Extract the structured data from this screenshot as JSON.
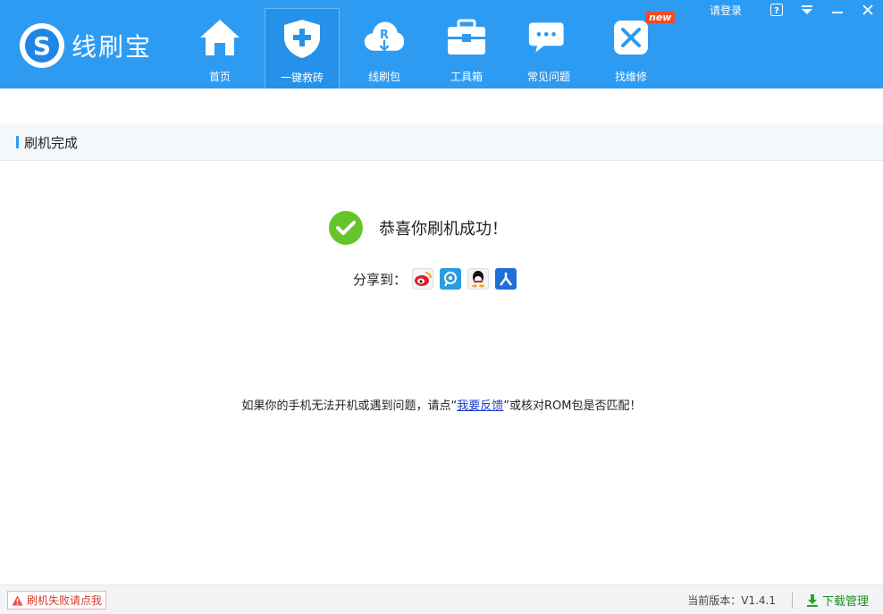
{
  "app": {
    "name": "线刷宝"
  },
  "nav": [
    {
      "label": "首页",
      "icon": "home-icon"
    },
    {
      "label": "一键救砖",
      "icon": "shield-plus-icon",
      "active": true
    },
    {
      "label": "线刷包",
      "icon": "cloud-download-icon"
    },
    {
      "label": "工具箱",
      "icon": "toolbox-icon"
    },
    {
      "label": "常见问题",
      "icon": "chat-bubbles-icon"
    },
    {
      "label": "找维修",
      "icon": "repair-tools-icon",
      "badge": "new"
    }
  ],
  "topbar": {
    "login": "请登录",
    "help_icon": "?"
  },
  "section": {
    "title": "刷机完成"
  },
  "result": {
    "message": "恭喜你刷机成功！",
    "share_label": "分享到："
  },
  "share_targets": [
    {
      "name": "weibo",
      "icon": "weibo-icon",
      "color": "#f4f4f4"
    },
    {
      "name": "tencent-weibo",
      "icon": "tencent-weibo-icon",
      "color": "#2a9be0"
    },
    {
      "name": "qq",
      "icon": "qq-penguin-icon",
      "color": "#f4f4f4"
    },
    {
      "name": "renren",
      "icon": "renren-icon",
      "color": "#1f6fd6"
    }
  ],
  "help": {
    "prefix": "如果你的手机无法开机或遇到问题，请点“",
    "link": "我要反馈",
    "suffix": "”或核对ROM包是否匹配！"
  },
  "footer": {
    "fail_button": "刷机失败请点我",
    "version_label": "当前版本：V1.4.1",
    "download": "下载管理"
  },
  "colors": {
    "header": "#2e9bf2",
    "success": "#66c42b",
    "link": "#1a3cc9",
    "fail": "#d43a2a",
    "download": "#1f8f1f"
  }
}
